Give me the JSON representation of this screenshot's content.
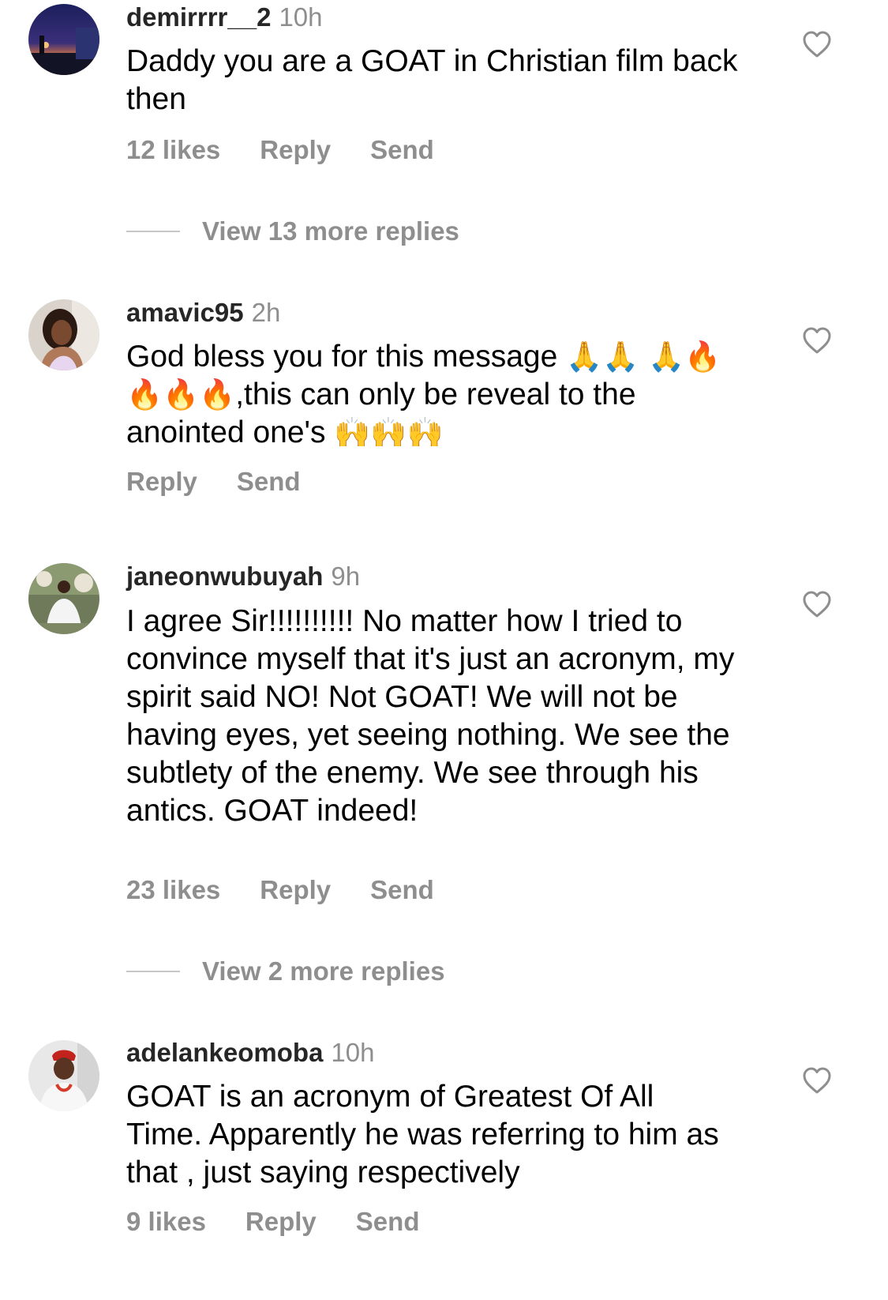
{
  "comments": [
    {
      "username": "demirrrr__2",
      "time": "10h",
      "text": "Daddy you are a GOAT in Christian film back then",
      "likes": "12 likes",
      "reply": "Reply",
      "send": "Send",
      "view_more": "View 13 more replies"
    },
    {
      "username": "amavic95",
      "time": "2h",
      "text_part1": "God bless you for this message ",
      "emoji1": "🙏🙏 🙏🔥🔥🔥🔥",
      "text_part2": ",this can only be reveal to the anointed one's ",
      "emoji2": "🙌🙌🙌",
      "reply": "Reply",
      "send": "Send"
    },
    {
      "username": "janeonwubuyah",
      "time": "9h",
      "text": "I agree Sir!!!!!!!!!! No matter how I tried to convince myself that it's just an acronym, my spirit said NO! Not GOAT! We will not be having eyes, yet seeing nothing. We see the subtlety of the enemy. We see through his antics. GOAT indeed!",
      "likes": "23 likes",
      "reply": "Reply",
      "send": "Send",
      "view_more": "View 2 more replies"
    },
    {
      "username": "adelankeomoba",
      "time": "10h",
      "text": "GOAT is an acronym of Greatest Of All Time. Apparently he was referring to him as that , just saying respectively",
      "likes": "9 likes",
      "reply": "Reply",
      "send": "Send"
    }
  ],
  "icons": {
    "like": "heart-outline-icon"
  },
  "colors": {
    "secondary_text": "#8e8e8e",
    "username": "#262626",
    "divider": "#c7c7c7"
  }
}
